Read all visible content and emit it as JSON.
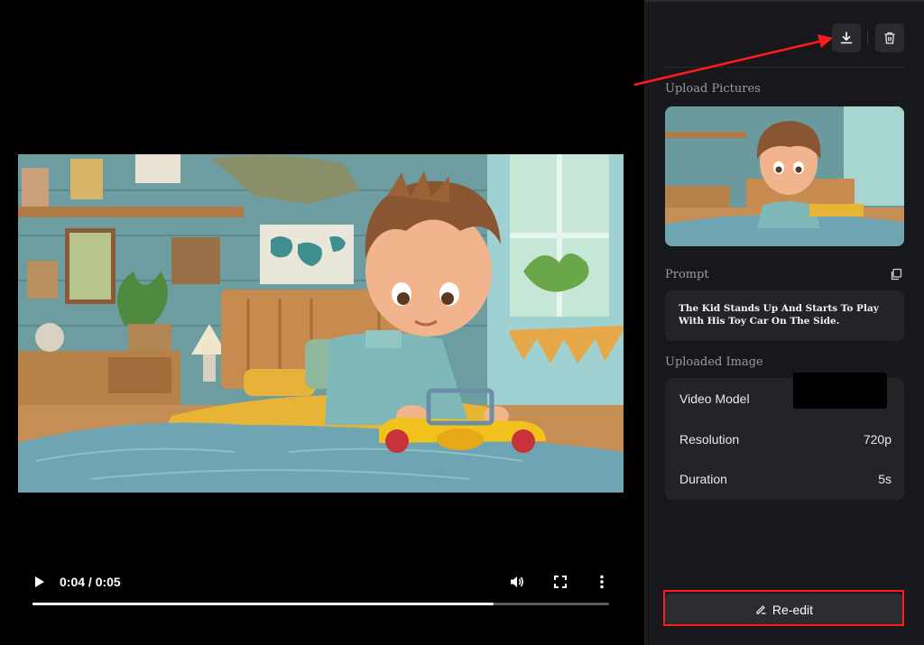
{
  "player": {
    "time_display": "0:04 / 0:05",
    "progress_fraction": 0.8
  },
  "panel": {
    "upload_pictures_label": "Upload Pictures",
    "prompt_label": "Prompt",
    "prompt_text": "The Kid Stands Up And Starts To Play With His Toy Car On The Side.",
    "uploaded_image_label": "Uploaded Image",
    "info": {
      "video_model_label": "Video Model",
      "video_model_value": "",
      "resolution_label": "Resolution",
      "resolution_value": "720p",
      "duration_label": "Duration",
      "duration_value": "5s"
    },
    "reedit_label": "Re-edit"
  },
  "icons": [
    "play-icon",
    "volume-icon",
    "fullscreen-icon",
    "more-vert-icon",
    "download-icon",
    "trash-icon",
    "copy-icon",
    "edit-icon"
  ],
  "colors": {
    "panel_bg": "#17181b",
    "card_bg": "#232428",
    "annotation_red": "#ff1b1b"
  }
}
